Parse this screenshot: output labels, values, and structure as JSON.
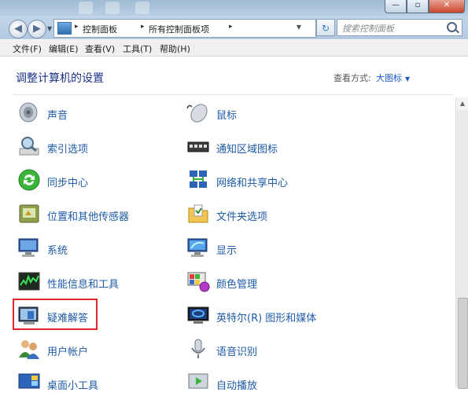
{
  "window": {
    "title_buttons": {
      "minimize": "—",
      "maximize": "▫",
      "close": "✕"
    }
  },
  "nav": {
    "back_icon": "back-arrow-icon",
    "forward_icon": "forward-arrow-icon",
    "breadcrumbs": [
      "控制面板",
      "所有控制面板项"
    ],
    "separator": "▸",
    "refresh_symbol": "↻",
    "search_placeholder": "搜索控制面板"
  },
  "menubar": {
    "items": [
      "文件(F)",
      "编辑(E)",
      "查看(V)",
      "工具(T)",
      "帮助(H)"
    ]
  },
  "content": {
    "heading": "调整计算机的设置",
    "view_by_label": "查看方式:",
    "view_by_value": "大图标"
  },
  "items": [
    {
      "label": "声音",
      "icon": "speaker-icon"
    },
    {
      "label": "鼠标",
      "icon": "mouse-icon"
    },
    {
      "label": "索引选项",
      "icon": "index-magnifier-icon"
    },
    {
      "label": "通知区域图标",
      "icon": "notification-tray-icon"
    },
    {
      "label": "同步中心",
      "icon": "sync-center-icon"
    },
    {
      "label": "网络和共享中心",
      "icon": "network-icon"
    },
    {
      "label": "位置和其他传感器",
      "icon": "sensor-icon"
    },
    {
      "label": "文件夹选项",
      "icon": "folder-options-icon"
    },
    {
      "label": "系统",
      "icon": "system-monitor-icon"
    },
    {
      "label": "显示",
      "icon": "display-icon"
    },
    {
      "label": "性能信息和工具",
      "icon": "performance-icon"
    },
    {
      "label": "颜色管理",
      "icon": "color-management-icon"
    },
    {
      "label": "疑难解答",
      "icon": "troubleshooting-icon"
    },
    {
      "label": "英特尔(R) 图形和媒体",
      "icon": "intel-graphics-icon"
    },
    {
      "label": "用户帐户",
      "icon": "user-accounts-icon"
    },
    {
      "label": "语音识别",
      "icon": "microphone-icon"
    },
    {
      "label": "桌面小工具",
      "icon": "desktop-gadgets-icon"
    },
    {
      "label": "自动播放",
      "icon": "autoplay-icon"
    }
  ],
  "colors": {
    "link": "#1e5ba8",
    "heading": "#1e3287",
    "highlight": "#e02626"
  }
}
